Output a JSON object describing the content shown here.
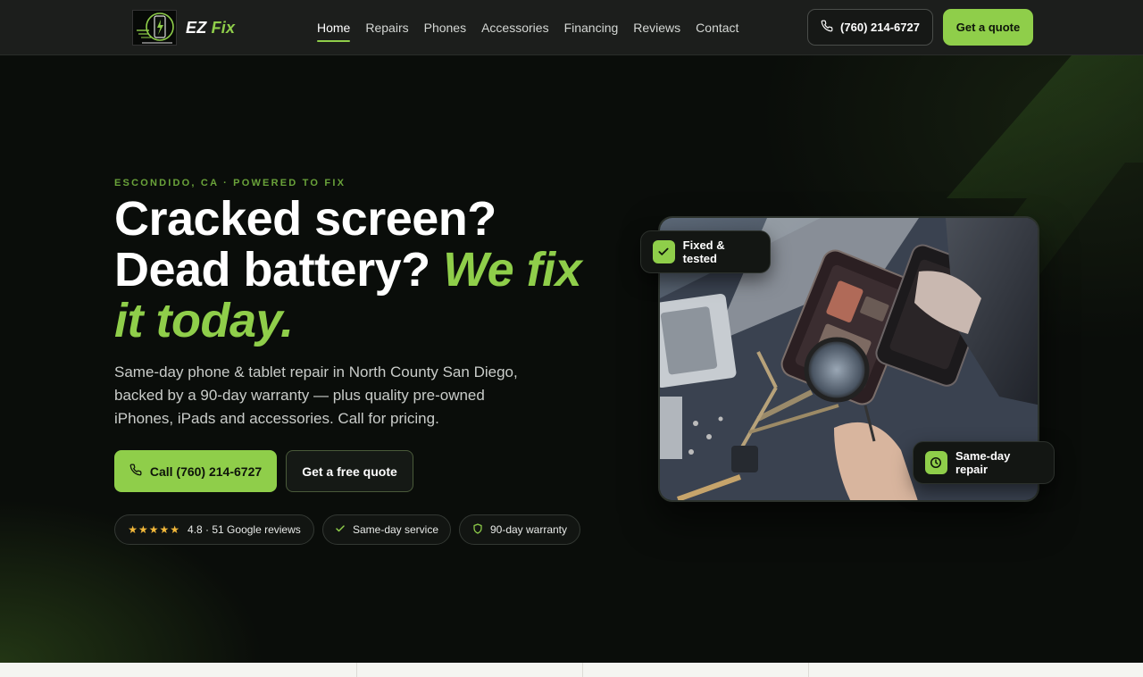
{
  "brand": {
    "name_part1": "EZ",
    "name_part2": "Fix",
    "accent_color": "#8fce4a"
  },
  "nav": {
    "items": [
      {
        "label": "Home",
        "active": true
      },
      {
        "label": "Repairs",
        "active": false
      },
      {
        "label": "Phones",
        "active": false
      },
      {
        "label": "Accessories",
        "active": false
      },
      {
        "label": "Financing",
        "active": false
      },
      {
        "label": "Reviews",
        "active": false
      },
      {
        "label": "Contact",
        "active": false
      }
    ],
    "phone_label": "(760) 214-6727",
    "quote_label": "Get a quote"
  },
  "hero": {
    "kicker": "ESCONDIDO, CA · POWERED TO FIX",
    "headline_plain": "Cracked screen? Dead battery? ",
    "headline_accent": "We fix it today.",
    "subcopy": "Same-day phone & tablet repair in North County San Diego, backed by a 90-day warranty — plus quality pre-owned iPhones, iPads and accessories. Call for pricing.",
    "cta_call_label": "Call (760) 214-6727",
    "cta_quote_label": "Get a free quote",
    "pills": {
      "rating_stars": "★★★★★",
      "rating_text": "4.8 · 51 Google reviews",
      "sameday_text": "Same-day service",
      "warranty_text": "90-day warranty"
    }
  },
  "photo": {
    "badge_fixed": "Fixed & tested",
    "badge_sameday": "Same-day repair"
  },
  "icons": {
    "phone": "phone-icon",
    "check": "check-icon",
    "shield": "shield-icon",
    "clock": "clock-icon",
    "star": "star-icon",
    "bolt": "lightning-bolt-icon"
  }
}
